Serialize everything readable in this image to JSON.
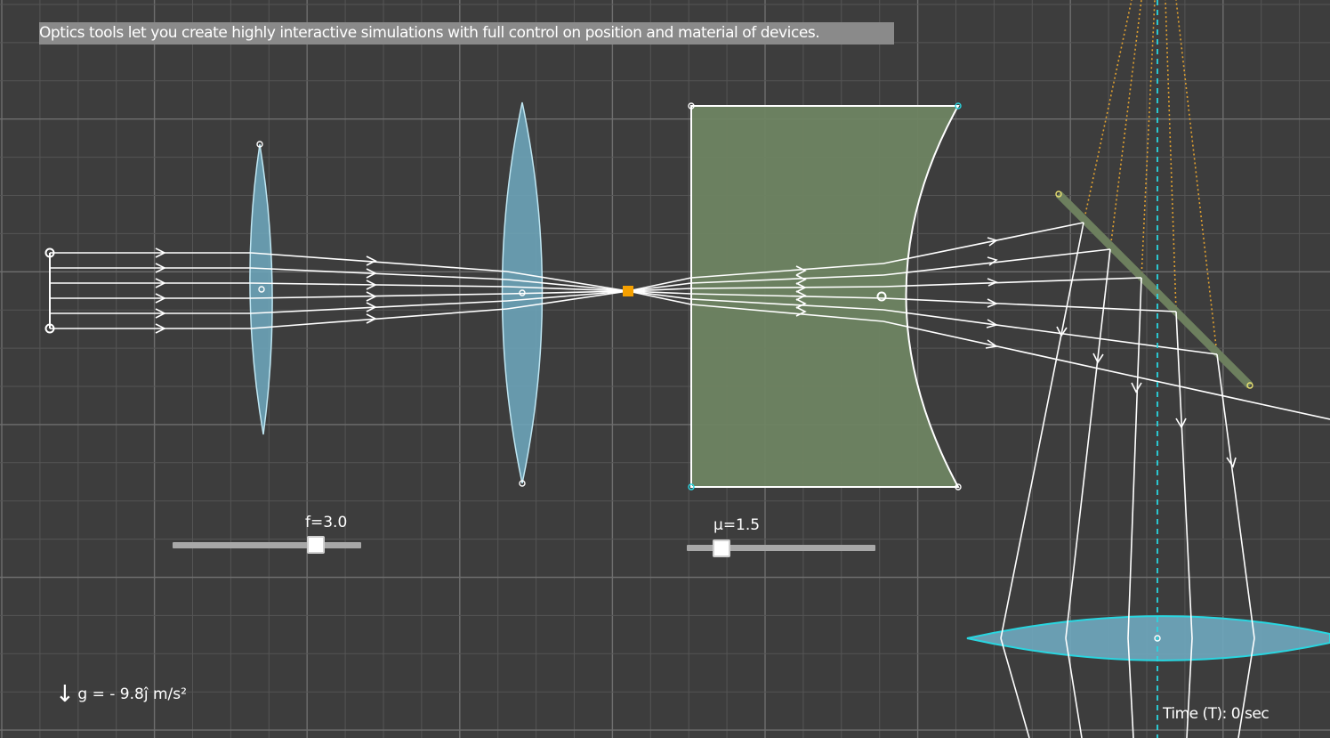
{
  "banner": {
    "text": "Optics tools let you create highly interactive simulations with full control on position and material of devices."
  },
  "focal_slider": {
    "label": "f=3.0",
    "value": 3.0,
    "fraction": 0.75
  },
  "index_slider": {
    "label": "μ=1.5",
    "value": 1.5,
    "fraction": 0.18
  },
  "gravity": {
    "text": "g =  - 9.8ĵ  m/s²",
    "icon": "down-arrow-icon"
  },
  "time": {
    "text": "Time (T): 0 sec"
  },
  "colors": {
    "background": "#3d3d3d",
    "grid": "#5a5a5a",
    "lens_fill": "#6fa9bf",
    "lens_stroke": "#bfe6f2",
    "glass_block": "#6a7b60",
    "ray": "#ffffff",
    "source_point": "#f5a000",
    "virtual_ray": "#e0a030",
    "axis": "#29d6e0",
    "mirror": "#6d7f5e"
  }
}
